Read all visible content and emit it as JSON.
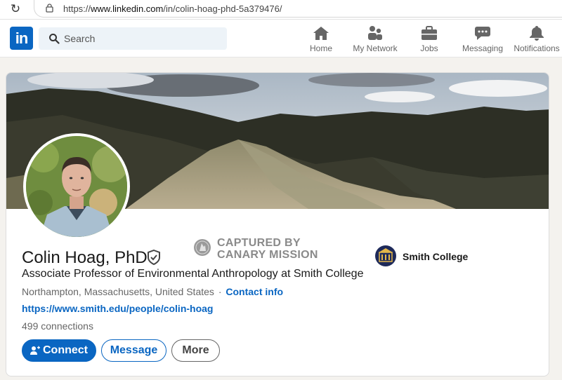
{
  "browser": {
    "url_prefix": "https://",
    "url_host": "www.linkedin.com",
    "url_path": "/in/colin-hoag-phd-5a379476/"
  },
  "nav": {
    "logo": "in",
    "search_placeholder": "Search",
    "items": [
      {
        "label": "Home",
        "icon": "home-icon"
      },
      {
        "label": "My Network",
        "icon": "network-icon"
      },
      {
        "label": "Jobs",
        "icon": "briefcase-icon"
      },
      {
        "label": "Messaging",
        "icon": "message-icon"
      },
      {
        "label": "Notifications",
        "icon": "bell-icon"
      }
    ]
  },
  "profile": {
    "name": "Colin Hoag, PhD",
    "headline": "Associate Professor of Environmental Anthropology at Smith College",
    "location": "Northampton, Massachusetts, United States",
    "separator": "·",
    "contact_label": "Contact info",
    "website": "https://www.smith.edu/people/colin-hoag",
    "connections": "499 connections",
    "education": "Smith College"
  },
  "watermark": {
    "line1": "CAPTURED BY",
    "line2": "CANARY MISSION"
  },
  "actions": {
    "connect": "Connect",
    "message": "Message",
    "more": "More"
  },
  "colors": {
    "linkedin_blue": "#0a66c2",
    "page_bg": "#f4f2ee"
  }
}
